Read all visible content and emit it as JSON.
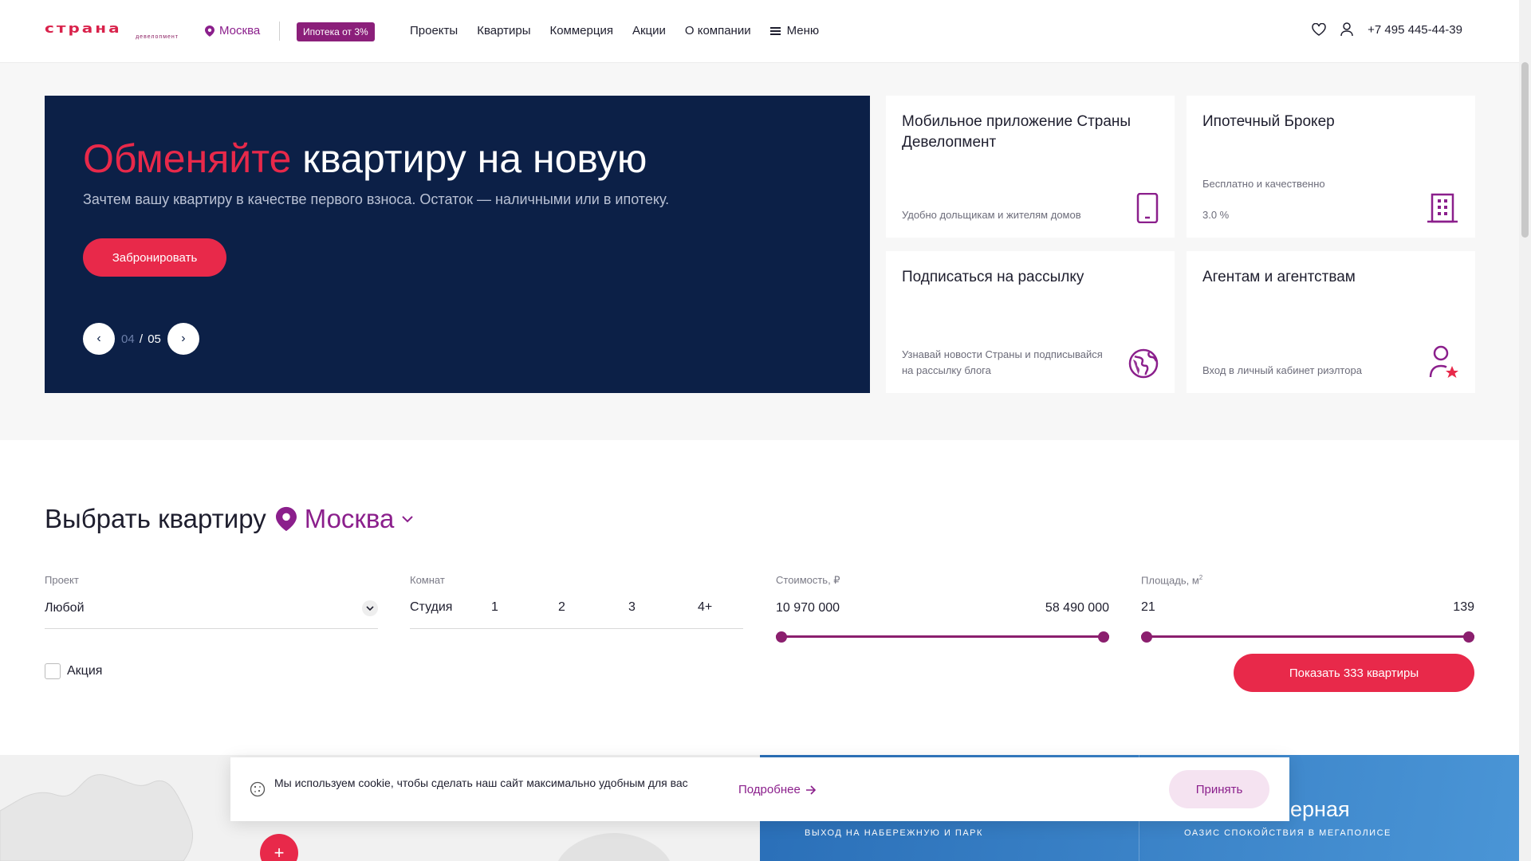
{
  "brand": {
    "name": "страна",
    "subtitle": "девелопмент",
    "accent": "#e8294a",
    "purple": "#8b1f8c",
    "navy": "#0c2047"
  },
  "header": {
    "city": "Москва",
    "mortgage_badge": "Ипотека от 3%",
    "nav": [
      "Проекты",
      "Квартиры",
      "Коммерция",
      "Акции",
      "О компании"
    ],
    "menu_label": "Меню",
    "phone": "+7 495 445-44-39"
  },
  "hero": {
    "title_accent": "Обменяйте",
    "title_rest": " квартиру на новую",
    "description": "Зачтем вашу квартиру в качестве первого взноса. Остаток — наличными или в ипотеку.",
    "button": "Забронировать",
    "slide_current": "04",
    "slide_sep": " / ",
    "slide_total": "05"
  },
  "cards": [
    {
      "title": "Мобильное приложение Страны Девелопмент",
      "subtitle": "Удобно дольщикам и жителям домов",
      "icon": "phone-icon"
    },
    {
      "title": "Ипотечный Брокер",
      "subtitle": "Бесплатно и качественно",
      "extra": "3.0 %",
      "icon": "building-icon"
    },
    {
      "title": "Подписаться на рассылку",
      "subtitle": "Узнавай новости Страны и подписывайся на рассылку блога",
      "icon": "globe-icon"
    },
    {
      "title": "Агентам и агентствам",
      "subtitle": "Вход в личный кабинет риэлтора",
      "icon": "agent-star-icon"
    }
  ],
  "filter": {
    "title": "Выбрать квартиру",
    "city": "Москва",
    "project": {
      "label": "Проект",
      "value": "Любой"
    },
    "rooms": {
      "label": "Комнат",
      "options": [
        "Студия",
        "1",
        "2",
        "3",
        "4+"
      ]
    },
    "price": {
      "label": "Стоимость, ₽",
      "min": "10 970 000",
      "max": "58 490 000"
    },
    "area": {
      "label": "Площадь, м",
      "unit_sup": "2",
      "min": "21",
      "max": "139"
    },
    "promo_label": "Акция",
    "show_button": "Показать 333 квартиры"
  },
  "projects": {
    "title_fragment": "ерная",
    "left_sub": "ВЫХОД НА НАБЕРЕЖНУЮ И ПАРК",
    "right_sub": "ОАЗИС СПОКОЙСТВИЯ В МЕГАПОЛИСЕ",
    "plus": "+"
  },
  "cookie": {
    "text": "Мы используем cookie, чтобы сделать наш сайт максимально удобным для вас",
    "more": "Подробнее",
    "accept": "Принять"
  }
}
